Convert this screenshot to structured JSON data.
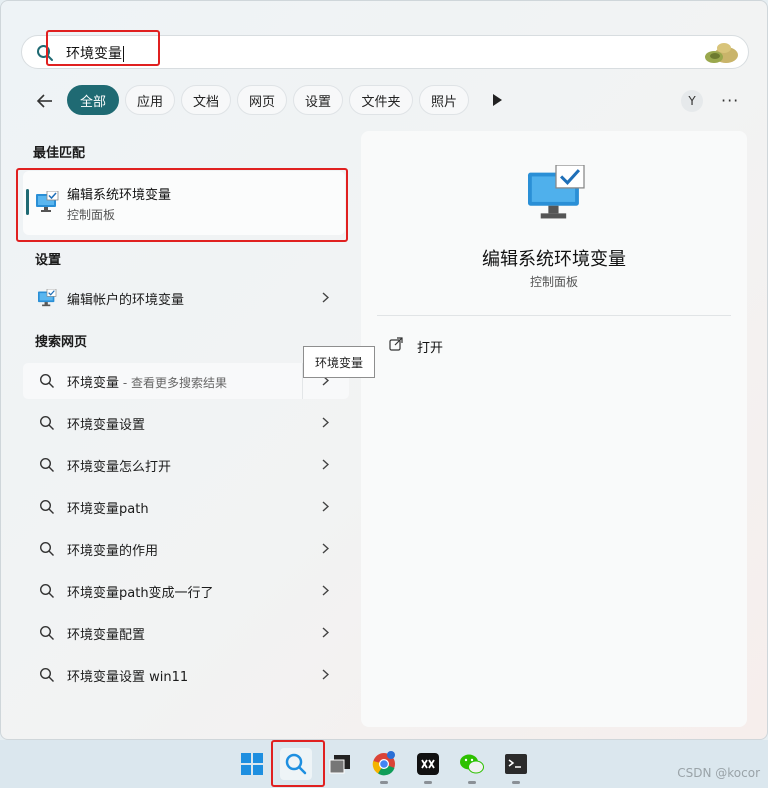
{
  "search": {
    "query": "环境变量"
  },
  "filters": {
    "back_label": "←",
    "chips": [
      "全部",
      "应用",
      "文档",
      "网页",
      "设置",
      "文件夹",
      "照片"
    ],
    "avatar_letter": "Y",
    "more_label": "···"
  },
  "best_match": {
    "section_title": "最佳匹配",
    "title": "编辑系统环境变量",
    "subtitle": "控制面板"
  },
  "settings": {
    "section_title": "设置",
    "item_label": "编辑帐户的环境变量"
  },
  "web": {
    "section_title": "搜索网页",
    "first_query": "环境变量",
    "first_hint": " - 查看更多搜索结果",
    "tooltip": "环境变量",
    "suggestions": [
      "环境变量设置",
      "环境变量怎么打开",
      "环境变量path",
      "环境变量的作用",
      "环境变量path变成一行了",
      "环境变量配置",
      "环境变量设置 win11"
    ]
  },
  "detail": {
    "title": "编辑系统环境变量",
    "subtitle": "控制面板",
    "open_label": "打开"
  },
  "taskbar": {
    "items": [
      "windows-start",
      "search",
      "task-view",
      "chrome",
      "app-x",
      "wechat",
      "terminal"
    ]
  },
  "watermark": "CSDN @kocor",
  "colors": {
    "accent": "#1f6a73",
    "highlight_box": "#e02020"
  }
}
